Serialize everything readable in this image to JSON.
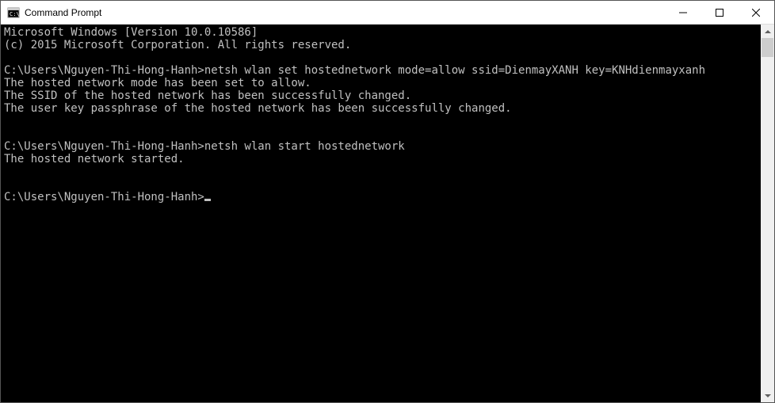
{
  "titlebar": {
    "title": "Command Prompt"
  },
  "console": {
    "lines": [
      "Microsoft Windows [Version 10.0.10586]",
      "(c) 2015 Microsoft Corporation. All rights reserved.",
      "",
      "C:\\Users\\Nguyen-Thi-Hong-Hanh>netsh wlan set hostednetwork mode=allow ssid=DienmayXANH key=KNHdienmayxanh",
      "The hosted network mode has been set to allow.",
      "The SSID of the hosted network has been successfully changed.",
      "The user key passphrase of the hosted network has been successfully changed.",
      "",
      "",
      "C:\\Users\\Nguyen-Thi-Hong-Hanh>netsh wlan start hostednetwork",
      "The hosted network started.",
      "",
      "",
      "C:\\Users\\Nguyen-Thi-Hong-Hanh>"
    ]
  }
}
